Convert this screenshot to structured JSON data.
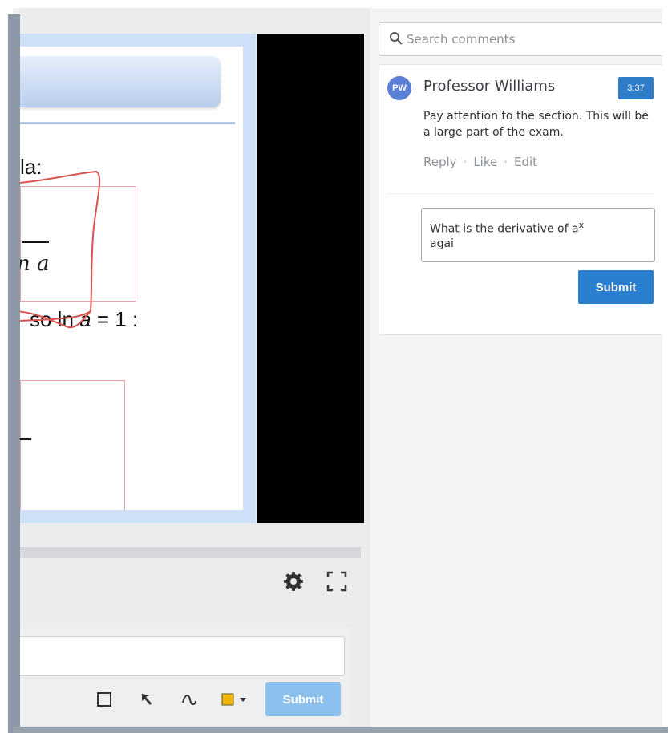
{
  "slide": {
    "line1": "la:",
    "line2_prefix": "so ln ",
    "line2_var": "a",
    "line2_suffix": " = 1 :",
    "denominator": "n a"
  },
  "player": {
    "settings_icon": "gear-icon",
    "fullscreen_icon": "fullscreen-icon"
  },
  "annotate": {
    "input_value": "",
    "tools": [
      "rectangle-icon",
      "arrow-cursor-icon",
      "freehand-icon",
      "color-swatch-icon"
    ],
    "color": "#f2b705",
    "submit_label": "Submit"
  },
  "comments": {
    "search_placeholder": "Search comments",
    "items": [
      {
        "avatar_initials": "PW",
        "author": "Professor Williams",
        "timestamp": "3:37",
        "text": "Pay attention to the section. This will be a large part of the exam.",
        "actions": {
          "reply": "Reply",
          "like": "Like",
          "edit": "Edit"
        }
      }
    ],
    "reply": {
      "text_prefix": "What is the derivative of a",
      "text_sup": "x",
      "text_suffix": "agai"
    },
    "submit_label": "Submit"
  },
  "colors": {
    "accent": "#2b7fd0",
    "timestamp_bg": "#2f7dc8",
    "avatar_bg": "#5b7fd4",
    "pen": "#d9534f"
  }
}
